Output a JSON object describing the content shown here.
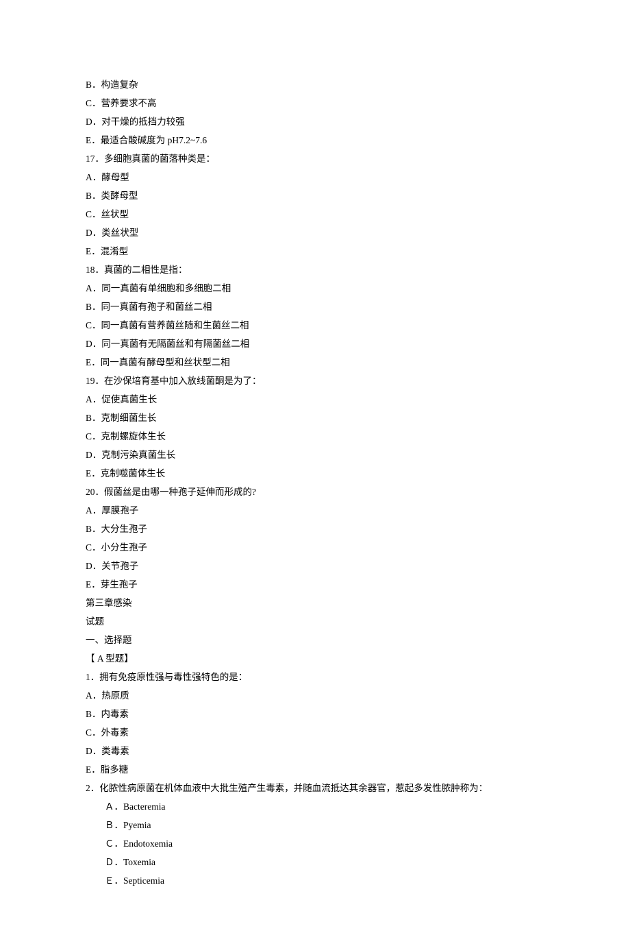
{
  "lines": [
    {
      "text": "B．构造复杂",
      "indent": false
    },
    {
      "text": "C．营养要求不高",
      "indent": false
    },
    {
      "text": "D．对干燥的抵挡力较强",
      "indent": false
    },
    {
      "text": "E．最适合酸碱度为 pH7.2~7.6",
      "indent": false
    },
    {
      "text": "17．多细胞真菌的菌落种类是：",
      "indent": false
    },
    {
      "text": "A．酵母型",
      "indent": false
    },
    {
      "text": "B．类酵母型",
      "indent": false
    },
    {
      "text": "C．丝状型",
      "indent": false
    },
    {
      "text": "D．类丝状型",
      "indent": false
    },
    {
      "text": "E．混淆型",
      "indent": false
    },
    {
      "text": "18．真菌的二相性是指：",
      "indent": false
    },
    {
      "text": "A．同一真菌有单细胞和多细胞二相",
      "indent": false
    },
    {
      "text": "B．同一真菌有孢子和菌丝二相",
      "indent": false
    },
    {
      "text": "C．同一真菌有营养菌丝随和生菌丝二相",
      "indent": false
    },
    {
      "text": "D．同一真菌有无隔菌丝和有隔菌丝二相",
      "indent": false
    },
    {
      "text": "E．同一真菌有酵母型和丝状型二相",
      "indent": false
    },
    {
      "text": "19．在沙保培育基中加入放线菌酮是为了：",
      "indent": false
    },
    {
      "text": "A．促使真菌生长",
      "indent": false
    },
    {
      "text": "B．克制细菌生长",
      "indent": false
    },
    {
      "text": "C．克制螺旋体生长",
      "indent": false
    },
    {
      "text": "D．克制污染真菌生长",
      "indent": false
    },
    {
      "text": "E．克制噬菌体生长",
      "indent": false
    },
    {
      "text": "20．假菌丝是由哪一种孢子延伸而形成的?",
      "indent": false
    },
    {
      "text": "A．厚膜孢子",
      "indent": false
    },
    {
      "text": "B．大分生孢子",
      "indent": false
    },
    {
      "text": "C．小分生孢子",
      "indent": false
    },
    {
      "text": "D．关节孢子",
      "indent": false
    },
    {
      "text": "E．芽生孢子",
      "indent": false
    },
    {
      "text": "第三章感染",
      "indent": false
    },
    {
      "text": "试题",
      "indent": false
    },
    {
      "text": "一、选择题",
      "indent": false
    },
    {
      "text": "【 A 型题】",
      "indent": false
    },
    {
      "text": "1．拥有免疫原性强与毒性强特色的是：",
      "indent": false
    },
    {
      "text": "A．热原质",
      "indent": false
    },
    {
      "text": "B．内毒素",
      "indent": false
    },
    {
      "text": "C．外毒素",
      "indent": false
    },
    {
      "text": "D．类毒素",
      "indent": false
    },
    {
      "text": "E．脂多糖",
      "indent": false
    },
    {
      "text": "2．化脓性病原菌在机体血液中大批生殖产生毒素，并随血流抵达其余器官，惹起多发性脓肿称为：",
      "indent": false
    },
    {
      "text": "Ａ．Bacteremia",
      "indent": true
    },
    {
      "text": "Ｂ．Pyemia",
      "indent": true
    },
    {
      "text": "Ｃ．Endotoxemia",
      "indent": true
    },
    {
      "text": "Ｄ．Toxemia",
      "indent": true
    },
    {
      "text": "Ｅ．Septicemia",
      "indent": true
    }
  ]
}
